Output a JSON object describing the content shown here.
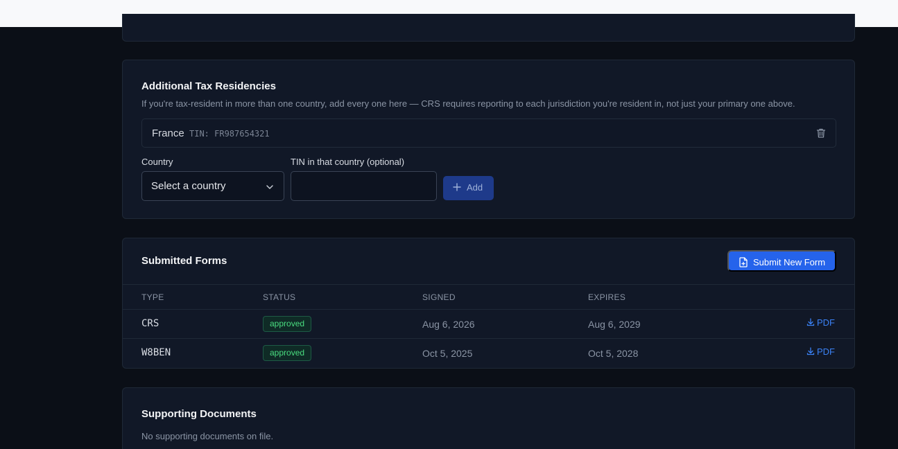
{
  "tax_residencies": {
    "title": "Additional Tax Residencies",
    "description": "If you're tax-resident in more than one country, add every one here — CRS requires reporting to each jurisdiction you're resident in, not just your primary one above.",
    "entries": [
      {
        "country": "France",
        "tin": "TIN: FR987654321"
      }
    ],
    "country_label": "Country",
    "country_select": "Select a country",
    "tin_label": "TIN in that country (optional)",
    "tin_value": "",
    "add_label": "Add"
  },
  "submitted_forms": {
    "title": "Submitted Forms",
    "submit_label": "Submit New Form",
    "columns": [
      "TYPE",
      "STATUS",
      "SIGNED",
      "EXPIRES"
    ],
    "rows": [
      {
        "type": "CRS",
        "status": "approved",
        "signed": "Aug 6, 2026",
        "expires": "Aug 6, 2029",
        "action": "PDF"
      },
      {
        "type": "W8BEN",
        "status": "approved",
        "signed": "Oct 5, 2025",
        "expires": "Oct 5, 2028",
        "action": "PDF"
      }
    ]
  },
  "supporting_documents": {
    "title": "Supporting Documents",
    "empty": "No supporting documents on file."
  },
  "colors": {
    "background": "#0b0f17",
    "card": "#111827",
    "primary": "#2563eb",
    "success": "#4ade80"
  }
}
